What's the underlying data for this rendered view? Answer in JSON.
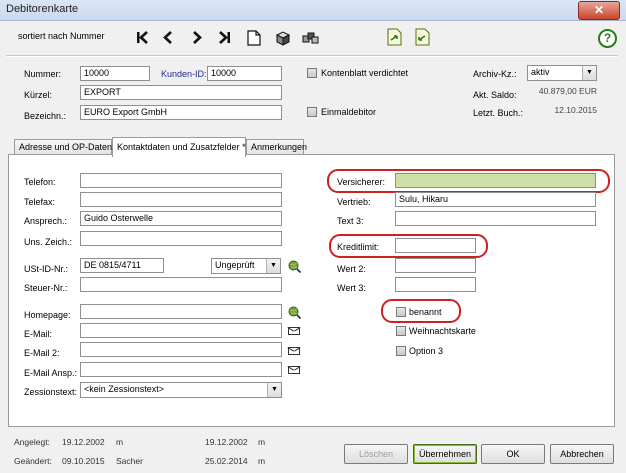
{
  "window": {
    "title": "Debitorenkarte",
    "close": "✕"
  },
  "toolbar": {
    "sort_label": "sortiert nach Nummer",
    "help": "?"
  },
  "header": {
    "nummer_label": "Nummer:",
    "nummer_value": "10000",
    "kunden_id_label": "Kunden-ID:",
    "kunden_id_value": "10000",
    "kuerzel_label": "Kürzel:",
    "kuerzel_value": "EXPORT",
    "bezeichn_label": "Bezeichn.:",
    "bezeichn_value": "EURO Export GmbH",
    "kontenblatt_label": "Kontenblatt verdichtet",
    "einmaldebitor_label": "Einmaldebitor",
    "archiv_label": "Archiv-Kz.:",
    "archiv_value": "aktiv",
    "saldo_label": "Akt. Saldo:",
    "saldo_value": "40.879,00 EUR",
    "letzt_label": "Letzt. Buch.:",
    "letzt_value": "12.10.2015"
  },
  "tabs": [
    {
      "label": "Adresse und OP-Daten"
    },
    {
      "label": "Kontaktdaten und Zusatzfelder *"
    },
    {
      "label": "Anmerkungen"
    }
  ],
  "left": {
    "telefon_label": "Telefon:",
    "telefon_value": "",
    "telefax_label": "Telefax:",
    "telefax_value": "",
    "ansprech_label": "Ansprech.:",
    "ansprech_value": "Guido Osterwelle",
    "uns_zeich_label": "Uns. Zeich.:",
    "uns_zeich_value": "",
    "ustid_label": "USt-ID-Nr.:",
    "ustid_value": "DE 0815/4711",
    "ustid_status": "Ungeprüft",
    "steuer_label": "Steuer-Nr.:",
    "steuer_value": "",
    "homepage_label": "Homepage:",
    "homepage_value": "",
    "email_label": "E-Mail:",
    "email_value": "",
    "email2_label": "E-Mail 2:",
    "email2_value": "",
    "email_ansp_label": "E-Mail Ansp.:",
    "email_ansp_value": "",
    "zession_label": "Zessionstext:",
    "zession_value": "<kein Zessionstext>"
  },
  "right": {
    "versicherer_label": "Versicherer:",
    "versicherer_value": "",
    "vertrieb_label": "Vertrieb:",
    "vertrieb_value": "Sulu, Hikaru",
    "text3_label": "Text 3:",
    "text3_value": "",
    "kreditlimit_label": "Kreditlimit:",
    "kreditlimit_value": "",
    "wert2_label": "Wert 2:",
    "wert2_value": "",
    "wert3_label": "Wert 3:",
    "wert3_value": "",
    "benannt_label": "benannt",
    "weihnachtskarte_label": "Weihnachtskarte",
    "option3_label": "Option 3"
  },
  "footer": {
    "angelegt_label": "Angelegt:",
    "angelegt_date": "19.12.2002",
    "angelegt_user": "m",
    "angelegt_date2": "19.12.2002",
    "angelegt_user2": "m",
    "geaendert_label": "Geändert:",
    "geaendert_date": "09.10.2015",
    "geaendert_user": "Sacher",
    "geaendert_date2": "25.02.2014",
    "geaendert_user2": "m"
  },
  "buttons": {
    "loeschen": "Löschen",
    "uebernehmen": "Übernehmen",
    "ok": "OK",
    "abbrechen": "Abbrechen"
  },
  "icons": [
    "first-record-icon",
    "previous-record-icon",
    "next-record-icon",
    "last-record-icon",
    "new-document-icon",
    "box-icon",
    "cubes-icon",
    "export-icon",
    "import-icon",
    "help-icon",
    "globe-search-icon",
    "mail-icon"
  ]
}
